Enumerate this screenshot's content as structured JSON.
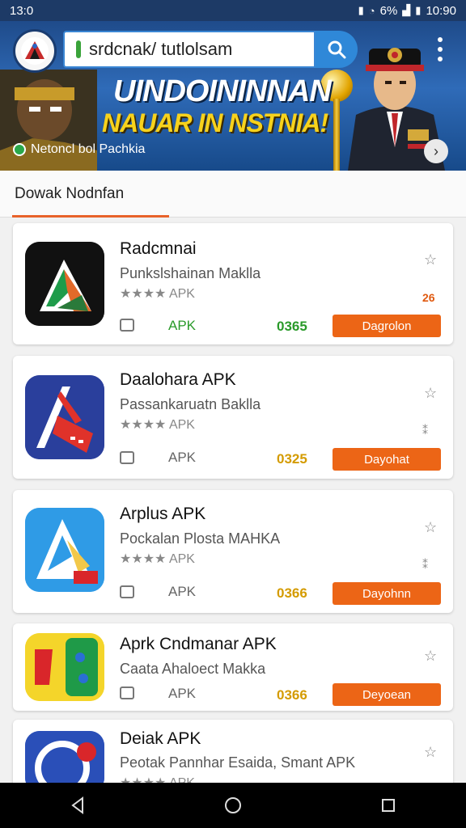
{
  "status_bar": {
    "time": "13:0",
    "battery_text": "6%",
    "clock_right": "10:90"
  },
  "search": {
    "value": "srdcnak/ tutlolsam"
  },
  "banner": {
    "title_line1": "UINDOININNAN",
    "title_line2": "NAUAR IN NSTNIA!",
    "caption": "Netoncl bol Pachkia"
  },
  "tab": {
    "label": "Dowak Nodnfan"
  },
  "apps": [
    {
      "name": "Radcmnai",
      "developer": "Punkslshainan Maklla",
      "rating": "★★★★ APK",
      "apk_label": "APK",
      "size": "0365",
      "download_label": "Dagrolon",
      "side_mark": "26"
    },
    {
      "name": "Daalohara APK",
      "developer": "Passankaruatn Baklla",
      "rating": "★★★★ APK",
      "apk_label": "APK",
      "size": "0325",
      "download_label": "Dayohat",
      "side_mark": "⁑"
    },
    {
      "name": "Arplus APK",
      "developer": "Pockalan Plosta MAHKA",
      "rating": "★★★★ APK",
      "apk_label": "APK",
      "size": "0366",
      "download_label": "Dayohnn",
      "side_mark": "⁑"
    },
    {
      "name": "Aprk Cndmanar APK",
      "developer": "Caata Ahaloect Makka",
      "rating": "",
      "apk_label": "APK",
      "size": "0366",
      "download_label": "Deyoean"
    },
    {
      "name": "Deiak APK",
      "developer": "Peotak Pannhar Esaida, Smant APK",
      "rating": "★★★★ APK"
    }
  ],
  "colors": {
    "header": "#2f6bb8",
    "accent": "#ec6516",
    "size_green": "#2a9a2a",
    "size_amber": "#d49b00"
  },
  "icons": [
    "signal-icon",
    "wifi-icon",
    "battery-icon",
    "search-icon",
    "menu-icon",
    "bookmark-icon",
    "back-icon",
    "home-icon",
    "recents-icon"
  ]
}
